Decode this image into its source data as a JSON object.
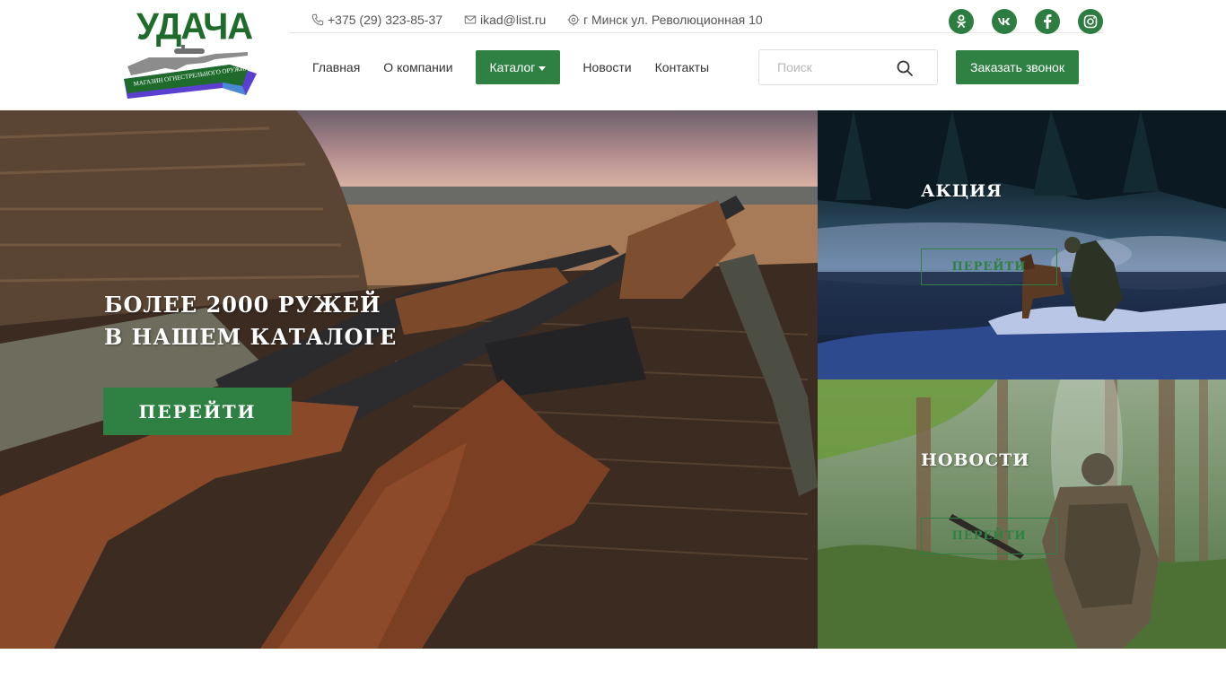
{
  "logo": {
    "title": "УДАЧА",
    "subtitle": "МАГАЗИН ОГНЕСТРЕЛЬНОГО ОРУЖИЯ"
  },
  "contacts": {
    "phone": "+375 (29) 323-85-37",
    "email": "ikad@list.ru",
    "address": "г Минск ул. Революционная 10"
  },
  "socials": [
    {
      "name": "odnoklassniki",
      "glyph": "ок"
    },
    {
      "name": "vk",
      "glyph": "vk"
    },
    {
      "name": "facebook",
      "glyph": "f"
    },
    {
      "name": "instagram",
      "glyph": "◎"
    }
  ],
  "nav": {
    "items": [
      "Главная",
      "О компании",
      "Каталог",
      "Новости",
      "Контакты"
    ],
    "active_index": 2
  },
  "search": {
    "placeholder": "Поиск"
  },
  "callback_button": "Заказать звонок",
  "hero": {
    "title_line1": "Более 2000 ружей",
    "title_line2": "в нашем каталоге",
    "button": "Перейти"
  },
  "panels": {
    "promo": {
      "title": "Акция",
      "button": "Перейти"
    },
    "news": {
      "title": "Новости",
      "button": "Перейти"
    }
  },
  "colors": {
    "brand_green": "#2e8142",
    "logo_green": "#1f6b2c"
  }
}
